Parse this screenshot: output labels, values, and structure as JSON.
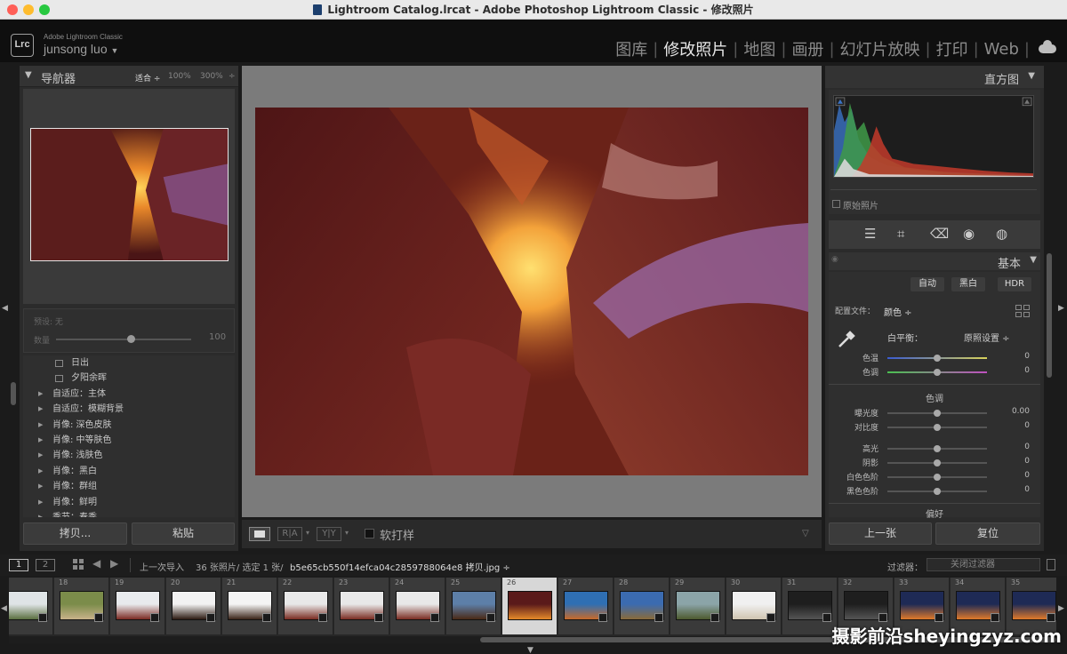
{
  "window": {
    "title": "Lightroom Catalog.lrcat - Adobe Photoshop Lightroom Classic - 修改照片",
    "traffic_lights": [
      "#ff5f57",
      "#febc2e",
      "#28c840"
    ]
  },
  "identity": {
    "logo": "Lrc",
    "app_name": "Adobe Lightroom Classic",
    "user": "junsong luo",
    "user_arrow": "▼"
  },
  "modules": [
    {
      "label": "图库",
      "active": false
    },
    {
      "label": "修改照片",
      "active": true
    },
    {
      "label": "地图",
      "active": false
    },
    {
      "label": "画册",
      "active": false
    },
    {
      "label": "幻灯片放映",
      "active": false
    },
    {
      "label": "打印",
      "active": false
    },
    {
      "label": "Web",
      "active": false
    }
  ],
  "cloud_icon": "cloud-icon",
  "navigator": {
    "title": "导航器",
    "zoom_fit": "适合 ÷",
    "zoom_100": "100%",
    "zoom_300": "300%",
    "zoom_more": "÷"
  },
  "preset_amount": {
    "preset_label": "预设: 无",
    "amount_label": "数量",
    "amount_value": "100",
    "amount_fraction": 0.55
  },
  "presets": [
    {
      "label": "日出",
      "kind": "item"
    },
    {
      "label": "夕阳余晖",
      "kind": "item"
    },
    {
      "label": "自适应：主体",
      "kind": "group"
    },
    {
      "label": "自适应：模糊背景",
      "kind": "group"
    },
    {
      "label": "肖像: 深色皮肤",
      "kind": "group"
    },
    {
      "label": "肖像: 中等肤色",
      "kind": "group"
    },
    {
      "label": "肖像: 浅肤色",
      "kind": "group"
    },
    {
      "label": "肖像：黑白",
      "kind": "group"
    },
    {
      "label": "肖像：群组",
      "kind": "group"
    },
    {
      "label": "肖像：鲜明",
      "kind": "group"
    },
    {
      "label": "季节：春季",
      "kind": "group"
    }
  ],
  "left_buttons": {
    "copy": "拷贝...",
    "paste": "粘贴"
  },
  "toolbar": {
    "view_buttons": [
      "▭",
      "R|A",
      "Y|Y"
    ],
    "soft_proof": "软打样"
  },
  "histogram": {
    "title": "直方图",
    "original_photo": "原始照片"
  },
  "tools": [
    "sliders-icon",
    "crop-icon",
    "eraser-icon",
    "redeye-icon",
    "mask-icon"
  ],
  "basic": {
    "title": "基本",
    "treatment": [
      "自动",
      "黑白",
      "HDR"
    ],
    "profile_label": "配置文件：",
    "profile_value": "颜色 ÷",
    "wb_label": "白平衡：",
    "wb_value": "原照设置 ÷",
    "tone_header": "色调",
    "presence_header": "偏好",
    "sliders_wb": [
      {
        "label": "色温",
        "value": "0",
        "pos": 0.5
      },
      {
        "label": "色调",
        "value": "0",
        "pos": 0.5
      }
    ],
    "sliders_tone": [
      {
        "label": "曝光度",
        "value": "0.00",
        "pos": 0.5
      },
      {
        "label": "对比度",
        "value": "0",
        "pos": 0.5
      }
    ],
    "sliders_tone2": [
      {
        "label": "高光",
        "value": "0",
        "pos": 0.5
      },
      {
        "label": "阴影",
        "value": "0",
        "pos": 0.5
      },
      {
        "label": "白色色阶",
        "value": "0",
        "pos": 0.5
      },
      {
        "label": "黑色色阶",
        "value": "0",
        "pos": 0.5
      }
    ]
  },
  "right_buttons": {
    "prev": "上一张",
    "reset": "复位"
  },
  "filmbar": {
    "page1": "1",
    "page2": "2",
    "source": "上一次导入",
    "counts": "36 张照片/ 选定 1 张/",
    "filename": "b5e65cb550f14efca04c2859788064e8 拷贝.jpg ÷",
    "filter_label": "过滤器：",
    "filter_value": "关闭过滤器"
  },
  "film_cells": [
    {
      "num": "",
      "selected": false,
      "colors": [
        "#dfe4e6",
        "#5a6f40"
      ]
    },
    {
      "num": "18",
      "selected": false,
      "colors": [
        "#7b8c4a",
        "#c8b28a"
      ]
    },
    {
      "num": "19",
      "selected": false,
      "colors": [
        "#e8eaed",
        "#7b2a22"
      ]
    },
    {
      "num": "20",
      "selected": false,
      "colors": [
        "#f2f2f2",
        "#2c1a12"
      ]
    },
    {
      "num": "21",
      "selected": false,
      "colors": [
        "#f4f4f4",
        "#3a2418"
      ]
    },
    {
      "num": "22",
      "selected": false,
      "colors": [
        "#e8e8e8",
        "#7a2c22"
      ]
    },
    {
      "num": "23",
      "selected": false,
      "colors": [
        "#e8e8e8",
        "#7a2c22"
      ]
    },
    {
      "num": "24",
      "selected": false,
      "colors": [
        "#e8e8e8",
        "#7a2c22"
      ]
    },
    {
      "num": "25",
      "selected": false,
      "colors": [
        "#5d7fa8",
        "#4a2a16"
      ]
    },
    {
      "num": "26",
      "selected": true,
      "colors": [
        "#5a1a1a",
        "#e58a2a"
      ]
    },
    {
      "num": "27",
      "selected": false,
      "colors": [
        "#2f6fb3",
        "#c76a2a"
      ]
    },
    {
      "num": "28",
      "selected": false,
      "colors": [
        "#3b6bb0",
        "#8a6b3a"
      ]
    },
    {
      "num": "29",
      "selected": false,
      "colors": [
        "#8ba4a8",
        "#4d5a2e"
      ]
    },
    {
      "num": "30",
      "selected": false,
      "colors": [
        "#f0f0f0",
        "#cfc4b0"
      ]
    },
    {
      "num": "31",
      "selected": false,
      "colors": [
        "#1e1e1e",
        "#555"
      ]
    },
    {
      "num": "32",
      "selected": false,
      "colors": [
        "#1e1e1e",
        "#555"
      ]
    },
    {
      "num": "33",
      "selected": false,
      "colors": [
        "#1e2a55",
        "#e07a2a"
      ]
    },
    {
      "num": "34",
      "selected": false,
      "colors": [
        "#1e2a55",
        "#e07a2a"
      ]
    },
    {
      "num": "35",
      "selected": false,
      "colors": [
        "#1e2a55",
        "#e07a2a"
      ]
    }
  ],
  "watermark": "摄影前沿sheyingzyz.com"
}
